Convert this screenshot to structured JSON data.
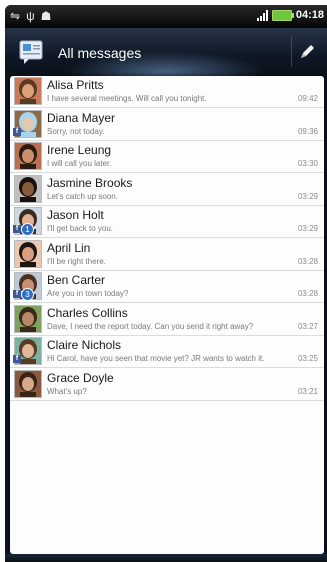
{
  "status_bar": {
    "time": "04:18"
  },
  "header": {
    "title": "All messages"
  },
  "colors": {
    "header_bg": "#0e1724",
    "list_bg": "#fdfdfd",
    "facebook_blue": "#3b5998",
    "badge_blue": "#2f6fc4"
  },
  "messages": [
    {
      "name": "Alisa Pritts",
      "preview": "I have several meetings. Will call you tonight.",
      "time": "09:42"
    },
    {
      "name": "Diana Mayer",
      "preview": "Sorry, not today.",
      "time": "09:36",
      "facebook": "f"
    },
    {
      "name": "Irene Leung",
      "preview": "I will call you later.",
      "time": "03:30"
    },
    {
      "name": "Jasmine Brooks",
      "preview": "Let's catch up soon.",
      "time": "03:29"
    },
    {
      "name": "Jason Holt",
      "preview": "I'll get back to you.",
      "time": "03:29",
      "facebook": "f",
      "count": "1"
    },
    {
      "name": "April Lin",
      "preview": "I'll be right there.",
      "time": "03:28"
    },
    {
      "name": "Ben Carter",
      "preview": "Are you in town today?",
      "time": "03:28",
      "facebook": "f",
      "count": "3"
    },
    {
      "name": "Charles Collins",
      "preview": "Dave, I need the report today. Can you send it right away?",
      "time": "03:27"
    },
    {
      "name": "Claire Nichols",
      "preview": "Hi Carol, have you seen that movie yet? JR wants to watch it.",
      "time": "03:25",
      "facebook": "f"
    },
    {
      "name": "Grace Doyle",
      "preview": "What's up?",
      "time": "03:21"
    }
  ]
}
